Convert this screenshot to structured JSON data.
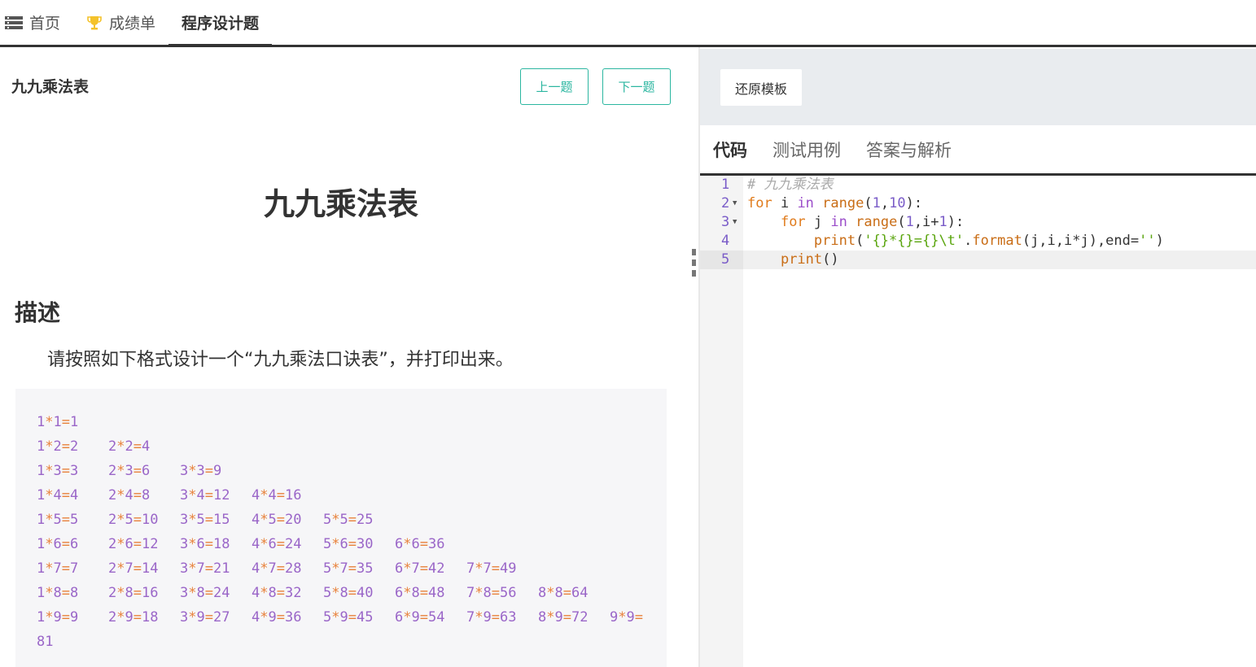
{
  "nav": {
    "tabs": [
      {
        "label": "首页",
        "icon": "list-icon"
      },
      {
        "label": "成绩单",
        "icon": "trophy-icon"
      },
      {
        "label": "程序设计题",
        "icon": ""
      }
    ],
    "active_index": 2
  },
  "problem": {
    "name": "九九乘法表",
    "prev_label": "上一题",
    "next_label": "下一题",
    "title": "九九乘法表",
    "section_heading": "描述",
    "description": "请按照如下格式设计一个“九九乘法口诀表”，并打印出来。",
    "sample_output": [
      [
        "1*1=1"
      ],
      [
        "1*2=2",
        "2*2=4"
      ],
      [
        "1*3=3",
        "2*3=6",
        "3*3=9"
      ],
      [
        "1*4=4",
        "2*4=8",
        "3*4=12",
        "4*4=16"
      ],
      [
        "1*5=5",
        "2*5=10",
        "3*5=15",
        "4*5=20",
        "5*5=25"
      ],
      [
        "1*6=6",
        "2*6=12",
        "3*6=18",
        "4*6=24",
        "5*6=30",
        "6*6=36"
      ],
      [
        "1*7=7",
        "2*7=14",
        "3*7=21",
        "4*7=28",
        "5*7=35",
        "6*7=42",
        "7*7=49"
      ],
      [
        "1*8=8",
        "2*8=16",
        "3*8=24",
        "4*8=32",
        "5*8=40",
        "6*8=48",
        "7*8=56",
        "8*8=64"
      ],
      [
        "1*9=9",
        "2*9=18",
        "3*9=27",
        "4*9=36",
        "5*9=45",
        "6*9=54",
        "7*9=63",
        "8*9=72",
        "9*9="
      ],
      [
        "81"
      ]
    ],
    "colors": {
      "accent": "#2bb6a0",
      "sample_text": "#9a66c8",
      "sample_operator": "#e8813a"
    }
  },
  "editor": {
    "reset_label": "还原模板",
    "tabs": [
      "代码",
      "测试用例",
      "答案与解析"
    ],
    "active_tab": 0,
    "line_numbers": [
      "1",
      "2",
      "3",
      "4",
      "5"
    ],
    "active_line": 5,
    "code": [
      "# 九九乘法表",
      "for i in range(1,10):",
      "    for j in range(1,i+1):",
      "        print('{}*{}={}\\t'.format(j,i,i*j),end='')",
      "    print()"
    ]
  }
}
